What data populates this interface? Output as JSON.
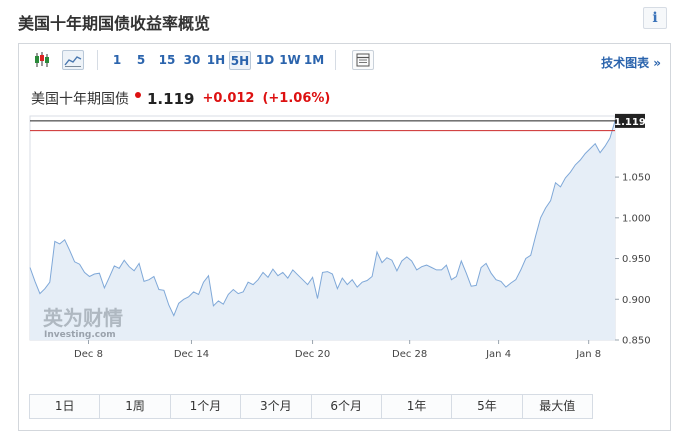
{
  "page": {
    "title": "美国十年期国债收益率概览",
    "info_label": "i"
  },
  "toolbar": {
    "chart_type_icons": [
      {
        "name": "candlestick-icon",
        "active": false
      },
      {
        "name": "area-chart-icon",
        "active": true
      }
    ],
    "periods": [
      "1",
      "5",
      "15",
      "30",
      "1H",
      "5H",
      "1D",
      "1W",
      "1M"
    ],
    "active_period": "5H",
    "settings_icon": "table-icon",
    "tech_chart_label": "技术图表 »"
  },
  "quote": {
    "name": "美国十年期国债",
    "price": "1.119",
    "change": "+0.012",
    "change_pct": "(+1.06%)",
    "up_color": "#dd1111"
  },
  "watermark": {
    "brand": "英为财情",
    "sub": "Investing.com"
  },
  "ranges": [
    "1日",
    "1周",
    "1个月",
    "3个月",
    "6个月",
    "1年",
    "5年",
    "最大值"
  ],
  "chart_data": {
    "type": "area",
    "title": "",
    "xlabel": "",
    "ylabel": "",
    "ylim": [
      0.85,
      1.125
    ],
    "yticks": [
      "0.850",
      "0.900",
      "0.950",
      "1.000",
      "1.050"
    ],
    "xticks": [
      "Dec 8",
      "Dec 14",
      "Dec 20",
      "Dec 28",
      "Jan 4",
      "Jan 8"
    ],
    "last_price_label": "1.119",
    "reference_level": 1.107,
    "line_color": "#7fa8d8",
    "fill_color": "#e6eef7",
    "grid": false,
    "values": [
      0.939,
      0.922,
      0.907,
      0.913,
      0.921,
      0.971,
      0.968,
      0.973,
      0.96,
      0.946,
      0.943,
      0.933,
      0.928,
      0.931,
      0.932,
      0.914,
      0.927,
      0.941,
      0.938,
      0.948,
      0.94,
      0.935,
      0.944,
      0.922,
      0.924,
      0.928,
      0.912,
      0.911,
      0.893,
      0.88,
      0.895,
      0.9,
      0.903,
      0.909,
      0.906,
      0.921,
      0.929,
      0.892,
      0.898,
      0.894,
      0.906,
      0.912,
      0.907,
      0.909,
      0.921,
      0.918,
      0.924,
      0.933,
      0.927,
      0.937,
      0.929,
      0.933,
      0.926,
      0.936,
      0.93,
      0.924,
      0.918,
      0.927,
      0.901,
      0.933,
      0.934,
      0.931,
      0.913,
      0.926,
      0.918,
      0.924,
      0.915,
      0.921,
      0.923,
      0.928,
      0.958,
      0.945,
      0.951,
      0.948,
      0.935,
      0.947,
      0.952,
      0.947,
      0.936,
      0.94,
      0.942,
      0.939,
      0.936,
      0.936,
      0.942,
      0.924,
      0.928,
      0.947,
      0.932,
      0.916,
      0.917,
      0.939,
      0.944,
      0.932,
      0.924,
      0.922,
      0.915,
      0.92,
      0.924,
      0.936,
      0.95,
      0.954,
      0.978,
      1.0,
      1.012,
      1.021,
      1.043,
      1.038,
      1.049,
      1.056,
      1.065,
      1.071,
      1.079,
      1.085,
      1.091,
      1.08,
      1.088,
      1.098,
      1.119
    ]
  }
}
